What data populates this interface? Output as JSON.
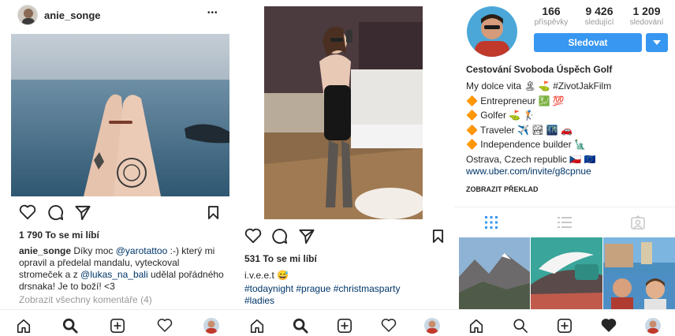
{
  "post1": {
    "username": "anie_songe",
    "more_label": "•••",
    "likes": "1 790 To se mi líbí",
    "caption_user": "anie_songe",
    "caption_part1": "Díky moc",
    "mention1": "@yarotattoo",
    "caption_part2": ":-) který mi opravil a předelal mandalu, vyteckoval stromeček a z",
    "mention2": "@lukas_na_bali",
    "caption_part3": "udělal pořádného drsnaka! Je to boží! <3",
    "view_comments": "Zobrazit všechny komentáře (4)"
  },
  "post2": {
    "likes": "531 To se mi líbí",
    "caption_user": "i.v.e.e.t",
    "caption_emoji": "😅",
    "hashtags_line1": "#todaynight #prague #christmasparty",
    "hashtags_line2": "#ladies"
  },
  "profile": {
    "stats": [
      {
        "value": "166",
        "label": "příspěvky"
      },
      {
        "value": "9 426",
        "label": "sledující"
      },
      {
        "value": "1 209",
        "label": "sledování"
      }
    ],
    "follow_label": "Sledovat",
    "name": "Cestování Svoboda Úspěch Golf",
    "bio_lines": [
      "My dolce vita 🏝 ⛳ #ZivotJakFilm",
      "🔶 Entrepreneur 💹 💯",
      "🔶 Golfer ⛳ 🏌",
      "🔶 Traveler ✈️ 🏞 🌃 🚗",
      "🔶 Independence builder 🗽",
      "Ostrava, Czech republic 🇨🇿 🇪🇺"
    ],
    "website": "www.uber.com/invite/g8cpnue",
    "translate_label": "ZOBRAZIT PŘEKLAD"
  },
  "colors": {
    "accent_blue": "#3897f0",
    "link_blue": "#003569",
    "muted_gray": "#999999",
    "border": "#dbdbdb"
  },
  "icons": [
    "heart-icon",
    "comment-icon",
    "share-icon",
    "bookmark-icon",
    "home-icon",
    "search-icon",
    "add-icon",
    "activity-icon",
    "grid-icon",
    "list-icon",
    "tagged-icon",
    "chevron-down-icon"
  ]
}
